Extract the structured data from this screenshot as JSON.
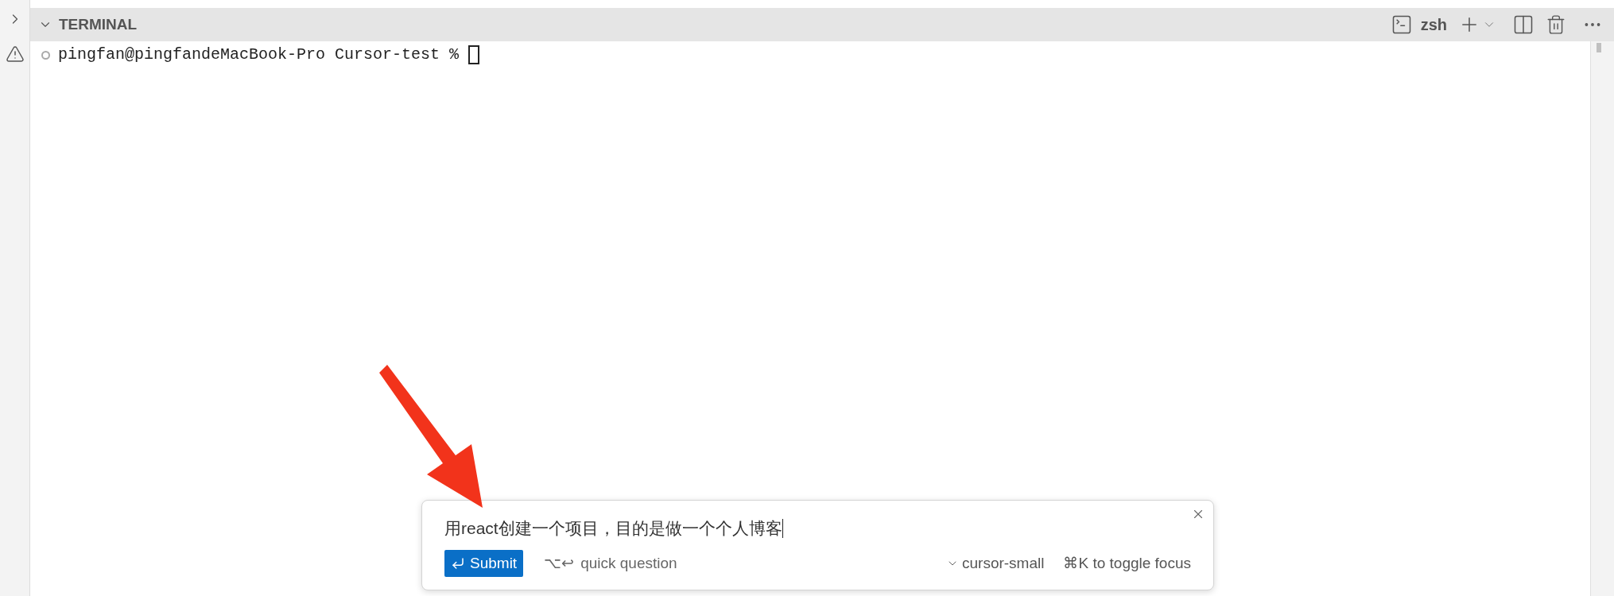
{
  "panel": {
    "title": "TERMINAL",
    "shell": "zsh"
  },
  "terminal": {
    "prompt": "pingfan@pingfandeMacBook-Pro Cursor-test %"
  },
  "prompt_box": {
    "value": "用react创建一个项目，目的是做一个个人博客",
    "submit": "Submit",
    "quick_keys": "⌥↩",
    "quick_label": "quick question",
    "model": "cursor-small",
    "focus_hint": "⌘K to toggle focus"
  }
}
